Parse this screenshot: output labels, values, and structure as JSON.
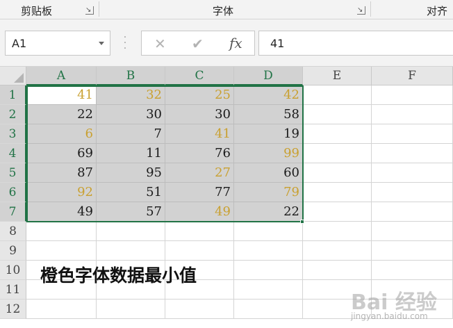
{
  "ribbon": {
    "groups": [
      {
        "label": "剪贴板"
      },
      {
        "label": "字体"
      },
      {
        "label": "对齐"
      }
    ]
  },
  "formula_bar": {
    "name_box": "A1",
    "cancel_icon": "close-icon",
    "enter_icon": "check-icon",
    "fx_label": "fx",
    "value": "41"
  },
  "sheet": {
    "columns": [
      "A",
      "B",
      "C",
      "D",
      "E",
      "F"
    ],
    "rows": [
      "1",
      "2",
      "3",
      "4",
      "5",
      "6",
      "7",
      "8",
      "9",
      "10",
      "11",
      "12"
    ],
    "values": [
      [
        "41",
        "32",
        "25",
        "42"
      ],
      [
        "22",
        "30",
        "30",
        "58"
      ],
      [
        "6",
        "7",
        "41",
        "19"
      ],
      [
        "69",
        "11",
        "76",
        "99"
      ],
      [
        "87",
        "95",
        "27",
        "60"
      ],
      [
        "92",
        "51",
        "77",
        "79"
      ],
      [
        "49",
        "57",
        "49",
        "22"
      ]
    ],
    "orange_cells": [
      [
        true,
        true,
        true,
        true
      ],
      [
        false,
        false,
        false,
        false
      ],
      [
        true,
        false,
        true,
        false
      ],
      [
        false,
        false,
        false,
        true
      ],
      [
        false,
        false,
        true,
        false
      ],
      [
        true,
        false,
        false,
        true
      ],
      [
        false,
        false,
        true,
        false
      ]
    ],
    "selection": "A1:D7",
    "active_cell": "A1",
    "note_cell": {
      "row": "10",
      "col": "A",
      "text": "橙色字体数据最小值"
    }
  },
  "colors": {
    "orange_font": "#c9a030",
    "black_font": "#1a1a1a",
    "selection_border": "#217346",
    "selection_fill": "#d2d2d2"
  },
  "watermark": {
    "logo": "Bai 经验",
    "site": "jingyan.baidu.com"
  }
}
